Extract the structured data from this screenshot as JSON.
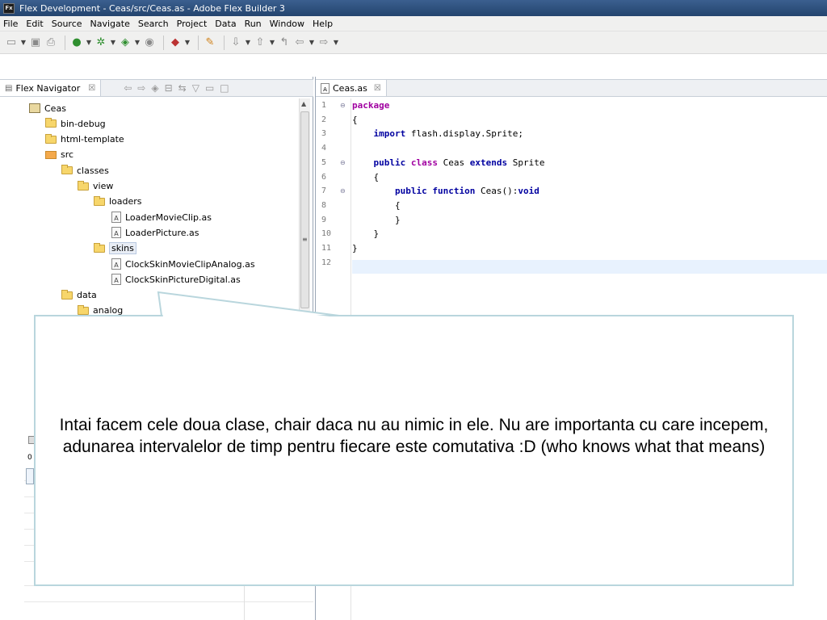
{
  "window": {
    "title": "Flex Development - Ceas/src/Ceas.as - Adobe Flex Builder 3",
    "app_icon_text": "Fx"
  },
  "menu": [
    "File",
    "Edit",
    "Source",
    "Navigate",
    "Search",
    "Project",
    "Data",
    "Run",
    "Window",
    "Help"
  ],
  "navigator": {
    "tab_label": "Flex Navigator",
    "tab_close": "☒",
    "tree": [
      {
        "label": "Ceas",
        "kind": "project",
        "depth": 0
      },
      {
        "label": "bin-debug",
        "kind": "folder",
        "depth": 1
      },
      {
        "label": "html-template",
        "kind": "folder",
        "depth": 1
      },
      {
        "label": "src",
        "kind": "source-folder",
        "depth": 1
      },
      {
        "label": "classes",
        "kind": "folder",
        "depth": 2
      },
      {
        "label": "view",
        "kind": "folder",
        "depth": 3
      },
      {
        "label": "loaders",
        "kind": "folder",
        "depth": 4
      },
      {
        "label": "LoaderMovieClip.as",
        "kind": "file",
        "depth": 5
      },
      {
        "label": "LoaderPicture.as",
        "kind": "file",
        "depth": 5
      },
      {
        "label": "skins",
        "kind": "folder",
        "depth": 4,
        "selected": true
      },
      {
        "label": "ClockSkinMovieClipAnalog.as",
        "kind": "file",
        "depth": 5
      },
      {
        "label": "ClockSkinPictureDigital.as",
        "kind": "file",
        "depth": 5
      },
      {
        "label": "data",
        "kind": "folder",
        "depth": 2
      },
      {
        "label": "analog",
        "kind": "folder",
        "depth": 3
      }
    ]
  },
  "lower_panel": {
    "value": "0"
  },
  "editor": {
    "tab_label": "Ceas.as",
    "tab_close": "☒",
    "lines": [
      {
        "n": "1",
        "fold": "⊖",
        "parts": [
          [
            "kw2",
            "package"
          ]
        ]
      },
      {
        "n": "2",
        "fold": "",
        "parts": [
          [
            "",
            "{"
          ]
        ]
      },
      {
        "n": "3",
        "fold": "",
        "parts": [
          [
            "",
            "    "
          ],
          [
            "kw",
            "import"
          ],
          [
            "",
            " flash.display.Sprite;"
          ]
        ]
      },
      {
        "n": "4",
        "fold": "",
        "parts": [
          [
            "",
            ""
          ]
        ]
      },
      {
        "n": "5",
        "fold": "⊖",
        "parts": [
          [
            "",
            "    "
          ],
          [
            "kw",
            "public"
          ],
          [
            "",
            " "
          ],
          [
            "kw2",
            "class"
          ],
          [
            "",
            " Ceas "
          ],
          [
            "kw",
            "extends"
          ],
          [
            "",
            " Sprite"
          ]
        ]
      },
      {
        "n": "6",
        "fold": "",
        "parts": [
          [
            "",
            "    {"
          ]
        ]
      },
      {
        "n": "7",
        "fold": "⊖",
        "parts": [
          [
            "",
            "        "
          ],
          [
            "kw",
            "public"
          ],
          [
            "",
            " "
          ],
          [
            "kw",
            "function"
          ],
          [
            "",
            " Ceas():"
          ],
          [
            "kw",
            "void"
          ]
        ]
      },
      {
        "n": "8",
        "fold": "",
        "parts": [
          [
            "",
            "        {"
          ]
        ]
      },
      {
        "n": "9",
        "fold": "",
        "parts": [
          [
            "",
            "        }"
          ]
        ]
      },
      {
        "n": "10",
        "fold": "",
        "parts": [
          [
            "",
            "    }"
          ]
        ]
      },
      {
        "n": "11",
        "fold": "",
        "parts": [
          [
            "",
            "}"
          ]
        ]
      },
      {
        "n": "12",
        "fold": "",
        "parts": [
          [
            "",
            ""
          ]
        ]
      }
    ]
  },
  "callout": {
    "text": "Intai facem cele doua clase, chair daca nu au nimic in ele. Nu are importanta cu care incepem, adunarea intervalelor de timp pentru fiecare este comutativa :D (who knows what that means)"
  },
  "colors": {
    "keyword": "#0000a0",
    "class_keyword": "#a000a0",
    "callout_border": "#b9d6dd",
    "titlebar": "#23446e"
  }
}
